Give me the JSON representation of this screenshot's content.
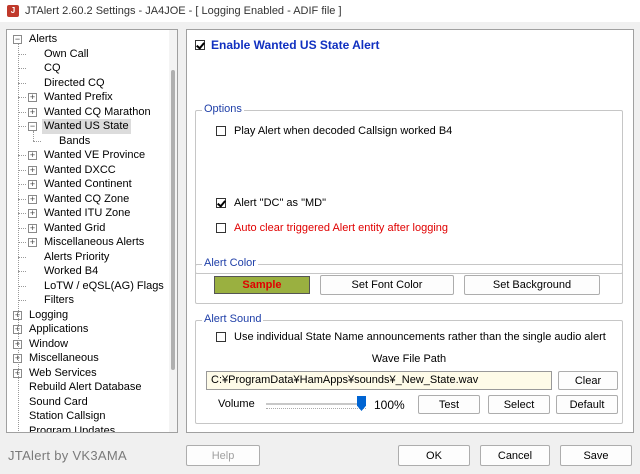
{
  "window": {
    "title": "JTAlert 2.60.2 Settings  -  JA4JOE  -  [ Logging Enabled - ADIF file ]"
  },
  "tree": [
    {
      "label": "Alerts",
      "level": 0,
      "expander": "−"
    },
    {
      "label": "Own Call",
      "level": 1
    },
    {
      "label": "CQ",
      "level": 1
    },
    {
      "label": "Directed CQ",
      "level": 1
    },
    {
      "label": "Wanted Prefix",
      "level": 1,
      "expander": "+"
    },
    {
      "label": "Wanted CQ Marathon",
      "level": 1,
      "expander": "+"
    },
    {
      "label": "Wanted US State",
      "level": 1,
      "expander": "−",
      "selected": true
    },
    {
      "label": "Bands",
      "level": 2
    },
    {
      "label": "Wanted VE Province",
      "level": 1,
      "expander": "+"
    },
    {
      "label": "Wanted DXCC",
      "level": 1,
      "expander": "+"
    },
    {
      "label": "Wanted Continent",
      "level": 1,
      "expander": "+"
    },
    {
      "label": "Wanted CQ Zone",
      "level": 1,
      "expander": "+"
    },
    {
      "label": "Wanted ITU Zone",
      "level": 1,
      "expander": "+"
    },
    {
      "label": "Wanted Grid",
      "level": 1,
      "expander": "+"
    },
    {
      "label": "Miscellaneous Alerts",
      "level": 1,
      "expander": "+"
    },
    {
      "label": "Alerts Priority",
      "level": 1
    },
    {
      "label": "Worked B4",
      "level": 1
    },
    {
      "label": "LoTW / eQSL(AG) Flags",
      "level": 1
    },
    {
      "label": "Filters",
      "level": 1
    },
    {
      "label": "Logging",
      "level": 0,
      "expander": "+"
    },
    {
      "label": "Applications",
      "level": 0,
      "expander": "+"
    },
    {
      "label": "Window",
      "level": 0,
      "expander": "+"
    },
    {
      "label": "Miscellaneous",
      "level": 0,
      "expander": "+"
    },
    {
      "label": "Web Services",
      "level": 0,
      "expander": "+"
    },
    {
      "label": "Rebuild Alert Database",
      "level": 0
    },
    {
      "label": "Sound Card",
      "level": 0
    },
    {
      "label": "Station Callsign",
      "level": 0
    },
    {
      "label": "Program Updates",
      "level": 0
    }
  ],
  "enable": {
    "label": "Enable Wanted US State Alert",
    "checked": true
  },
  "options": {
    "title": "Options",
    "play_b4": {
      "label": "Play Alert when decoded Callsign worked B4",
      "checked": false
    },
    "dc_md": {
      "label": "Alert \"DC\" as \"MD\"",
      "checked": true
    },
    "auto_clear": {
      "label": "Auto clear triggered Alert entity after logging",
      "checked": false
    }
  },
  "alert_color": {
    "title": "Alert Color",
    "sample_label": "Sample",
    "sample_bg": "#9ab040",
    "sample_fg": "#e00000",
    "set_font_label": "Set Font Color",
    "set_bg_label": "Set Background"
  },
  "alert_sound": {
    "title": "Alert Sound",
    "individual": {
      "label": "Use individual State Name announcements rather than the single audio alert",
      "checked": false
    },
    "wave_path_label": "Wave File Path",
    "wave_path": "C:¥ProgramData¥HamApps¥sounds¥_New_State.wav",
    "clear_label": "Clear",
    "volume_label": "Volume",
    "volume_value": 100,
    "volume_text": "100%",
    "test_label": "Test",
    "select_label": "Select",
    "default_label": "Default"
  },
  "footer": {
    "brand": "JTAlert by VK3AMA",
    "help_label": "Help",
    "ok_label": "OK",
    "cancel_label": "Cancel",
    "save_label": "Save"
  }
}
